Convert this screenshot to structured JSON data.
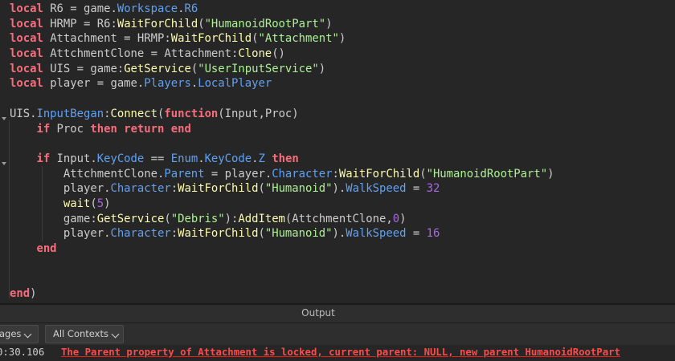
{
  "editor": {
    "lines": [
      [
        {
          "t": "local",
          "c": "keyword"
        },
        {
          "t": " R6 = game.",
          "c": "text"
        },
        {
          "t": "Workspace",
          "c": "member"
        },
        {
          "t": ".",
          "c": "text"
        },
        {
          "t": "R6",
          "c": "member"
        }
      ],
      [
        {
          "t": "local",
          "c": "keyword"
        },
        {
          "t": " HRMP = R6:",
          "c": "text"
        },
        {
          "t": "WaitForChild",
          "c": "method"
        },
        {
          "t": "(",
          "c": "text"
        },
        {
          "t": "\"HumanoidRootPart\"",
          "c": "string"
        },
        {
          "t": ")",
          "c": "text"
        }
      ],
      [
        {
          "t": "local",
          "c": "keyword"
        },
        {
          "t": " Attachment = HRMP:",
          "c": "text"
        },
        {
          "t": "WaitForChild",
          "c": "method"
        },
        {
          "t": "(",
          "c": "text"
        },
        {
          "t": "\"Attachment\"",
          "c": "string"
        },
        {
          "t": ")",
          "c": "text"
        }
      ],
      [
        {
          "t": "local",
          "c": "keyword"
        },
        {
          "t": " AttchmentClone = Attachment:",
          "c": "text"
        },
        {
          "t": "Clone",
          "c": "method"
        },
        {
          "t": "()",
          "c": "text"
        }
      ],
      [
        {
          "t": "local",
          "c": "keyword"
        },
        {
          "t": " UIS = game:",
          "c": "text"
        },
        {
          "t": "GetService",
          "c": "method"
        },
        {
          "t": "(",
          "c": "text"
        },
        {
          "t": "\"UserInputService\"",
          "c": "string"
        },
        {
          "t": ")",
          "c": "text"
        }
      ],
      [
        {
          "t": "local",
          "c": "keyword"
        },
        {
          "t": " player = game.",
          "c": "text"
        },
        {
          "t": "Players",
          "c": "member"
        },
        {
          "t": ".",
          "c": "text"
        },
        {
          "t": "LocalPlayer",
          "c": "member"
        }
      ],
      [],
      [
        {
          "t": "UIS.",
          "c": "text"
        },
        {
          "t": "InputBegan",
          "c": "member"
        },
        {
          "t": ":",
          "c": "text"
        },
        {
          "t": "Connect",
          "c": "method"
        },
        {
          "t": "(",
          "c": "text"
        },
        {
          "t": "function",
          "c": "keyword"
        },
        {
          "t": "(Input,Proc)",
          "c": "text"
        }
      ],
      [
        {
          "t": "    ",
          "c": "text"
        },
        {
          "t": "if",
          "c": "keyword"
        },
        {
          "t": " Proc ",
          "c": "text"
        },
        {
          "t": "then",
          "c": "keyword"
        },
        {
          "t": " ",
          "c": "text"
        },
        {
          "t": "return",
          "c": "keyword"
        },
        {
          "t": " ",
          "c": "text"
        },
        {
          "t": "end",
          "c": "keyword"
        }
      ],
      [],
      [
        {
          "t": "    ",
          "c": "text"
        },
        {
          "t": "if",
          "c": "keyword"
        },
        {
          "t": " Input.",
          "c": "text"
        },
        {
          "t": "KeyCode",
          "c": "member"
        },
        {
          "t": " == ",
          "c": "text"
        },
        {
          "t": "Enum",
          "c": "member"
        },
        {
          "t": ".",
          "c": "text"
        },
        {
          "t": "KeyCode",
          "c": "member"
        },
        {
          "t": ".",
          "c": "text"
        },
        {
          "t": "Z",
          "c": "member"
        },
        {
          "t": " ",
          "c": "text"
        },
        {
          "t": "then",
          "c": "keyword"
        }
      ],
      [
        {
          "t": "        AttchmentClone.",
          "c": "text"
        },
        {
          "t": "Parent",
          "c": "member"
        },
        {
          "t": " = player.",
          "c": "text"
        },
        {
          "t": "Character",
          "c": "member"
        },
        {
          "t": ":",
          "c": "text"
        },
        {
          "t": "WaitForChild",
          "c": "method"
        },
        {
          "t": "(",
          "c": "text"
        },
        {
          "t": "\"HumanoidRootPart\"",
          "c": "string"
        },
        {
          "t": ")",
          "c": "text"
        }
      ],
      [
        {
          "t": "        player.",
          "c": "text"
        },
        {
          "t": "Character",
          "c": "member"
        },
        {
          "t": ":",
          "c": "text"
        },
        {
          "t": "WaitForChild",
          "c": "method"
        },
        {
          "t": "(",
          "c": "text"
        },
        {
          "t": "\"Humanoid\"",
          "c": "string"
        },
        {
          "t": ").",
          "c": "text"
        },
        {
          "t": "WalkSpeed",
          "c": "member"
        },
        {
          "t": " = ",
          "c": "text"
        },
        {
          "t": "32",
          "c": "number"
        }
      ],
      [
        {
          "t": "        ",
          "c": "text"
        },
        {
          "t": "wait",
          "c": "method"
        },
        {
          "t": "(",
          "c": "text"
        },
        {
          "t": "5",
          "c": "number"
        },
        {
          "t": ")",
          "c": "text"
        }
      ],
      [
        {
          "t": "        game:",
          "c": "text"
        },
        {
          "t": "GetService",
          "c": "method"
        },
        {
          "t": "(",
          "c": "text"
        },
        {
          "t": "\"Debris\"",
          "c": "string"
        },
        {
          "t": "):",
          "c": "text"
        },
        {
          "t": "AddItem",
          "c": "method"
        },
        {
          "t": "(AttchmentClone,",
          "c": "text"
        },
        {
          "t": "0",
          "c": "number"
        },
        {
          "t": ")",
          "c": "text"
        }
      ],
      [
        {
          "t": "        player.",
          "c": "text"
        },
        {
          "t": "Character",
          "c": "member"
        },
        {
          "t": ":",
          "c": "text"
        },
        {
          "t": "WaitForChild",
          "c": "method"
        },
        {
          "t": "(",
          "c": "text"
        },
        {
          "t": "\"Humanoid\"",
          "c": "string"
        },
        {
          "t": ").",
          "c": "text"
        },
        {
          "t": "WalkSpeed",
          "c": "member"
        },
        {
          "t": " = ",
          "c": "text"
        },
        {
          "t": "16",
          "c": "number"
        }
      ],
      [
        {
          "t": "    ",
          "c": "text"
        },
        {
          "t": "end",
          "c": "keyword"
        }
      ],
      [],
      [],
      [
        {
          "t": "end",
          "c": "keyword"
        },
        {
          "t": ")",
          "c": "text"
        }
      ]
    ]
  },
  "output": {
    "title": "Output",
    "filter_messages_label": "ages",
    "filter_contexts_label": "All Contexts",
    "log": {
      "time": "0:30.106",
      "message": "The Parent property of Attachment is locked, current parent: NULL, new parent HumanoidRootPart"
    }
  },
  "colors": {
    "keyword": "#f86d7c",
    "method": "#fdfbac",
    "member": "#61a1f1",
    "string": "#adf195",
    "number": "#a769e2",
    "text": "#cccccc",
    "error": "#ff4a4a",
    "background": "#262626"
  }
}
